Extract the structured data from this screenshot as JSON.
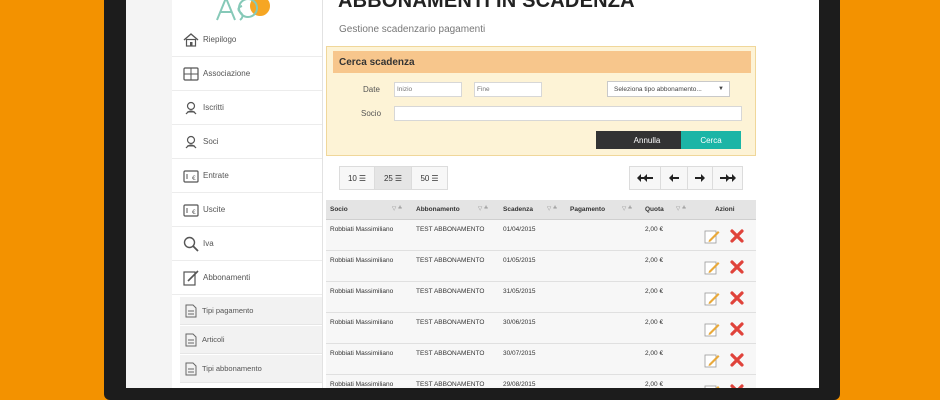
{
  "page": {
    "title": "ABBONAMENTI IN SCADENZA",
    "subtitle": "Gestione scadenzario pagamenti"
  },
  "sidebar": {
    "items": [
      {
        "label": "Riepilogo",
        "icon": "home-icon"
      },
      {
        "label": "Associazione",
        "icon": "building-icon"
      },
      {
        "label": "Iscritti",
        "icon": "user-icon"
      },
      {
        "label": "Soci",
        "icon": "user-icon"
      },
      {
        "label": "Entrate",
        "icon": "wallet-in-icon"
      },
      {
        "label": "Uscite",
        "icon": "wallet-out-icon"
      },
      {
        "label": "Iva",
        "icon": "magnifier-icon"
      },
      {
        "label": "Abbonamenti",
        "icon": "edit-icon"
      }
    ],
    "subitems": [
      {
        "label": "Tipi pagamento",
        "icon": "document-icon"
      },
      {
        "label": "Articoli",
        "icon": "document-icon"
      },
      {
        "label": "Tipi abbonamento",
        "icon": "document-icon"
      }
    ]
  },
  "search": {
    "header": "Cerca scadenza",
    "date_label": "Date",
    "date_start_placeholder": "Inizio",
    "date_end_placeholder": "Fine",
    "type_select_value": "Seleziona tipo abbonamento...",
    "socio_label": "Socio",
    "cancel_label": "Annulla",
    "search_label": "Cerca"
  },
  "page_size": {
    "options": [
      "10",
      "25",
      "50"
    ],
    "selected": "25"
  },
  "pager": {
    "first": "first-page-icon",
    "prev": "prev-page-icon",
    "next": "next-page-icon",
    "last": "last-page-icon"
  },
  "table": {
    "columns": [
      "Socio",
      "Abbonamento",
      "Scadenza",
      "Pagamento",
      "Quota",
      "Azioni"
    ],
    "rows": [
      {
        "socio": "Robbiati Massimiliano",
        "abbonamento": "TEST ABBONAMENTO",
        "scadenza": "01/04/2015",
        "pagamento": "",
        "quota": "2,00 €"
      },
      {
        "socio": "Robbiati Massimiliano",
        "abbonamento": "TEST ABBONAMENTO",
        "scadenza": "01/05/2015",
        "pagamento": "",
        "quota": "2,00 €"
      },
      {
        "socio": "Robbiati Massimiliano",
        "abbonamento": "TEST ABBONAMENTO",
        "scadenza": "31/05/2015",
        "pagamento": "",
        "quota": "2,00 €"
      },
      {
        "socio": "Robbiati Massimiliano",
        "abbonamento": "TEST ABBONAMENTO",
        "scadenza": "30/06/2015",
        "pagamento": "",
        "quota": "2,00 €"
      },
      {
        "socio": "Robbiati Massimiliano",
        "abbonamento": "TEST ABBONAMENTO",
        "scadenza": "30/07/2015",
        "pagamento": "",
        "quota": "2,00 €"
      },
      {
        "socio": "Robbiati Massimiliano",
        "abbonamento": "TEST ABBONAMENTO",
        "scadenza": "29/08/2015",
        "pagamento": "",
        "quota": "2,00 €"
      }
    ]
  },
  "colors": {
    "background": "#f39200",
    "search_header": "#f7c68c",
    "search_panel": "#fdf3d6",
    "cancel_button": "#333333",
    "search_button": "#1bb5a6",
    "edit_icon": "#e9a93b",
    "delete_icon": "#e0433b"
  }
}
